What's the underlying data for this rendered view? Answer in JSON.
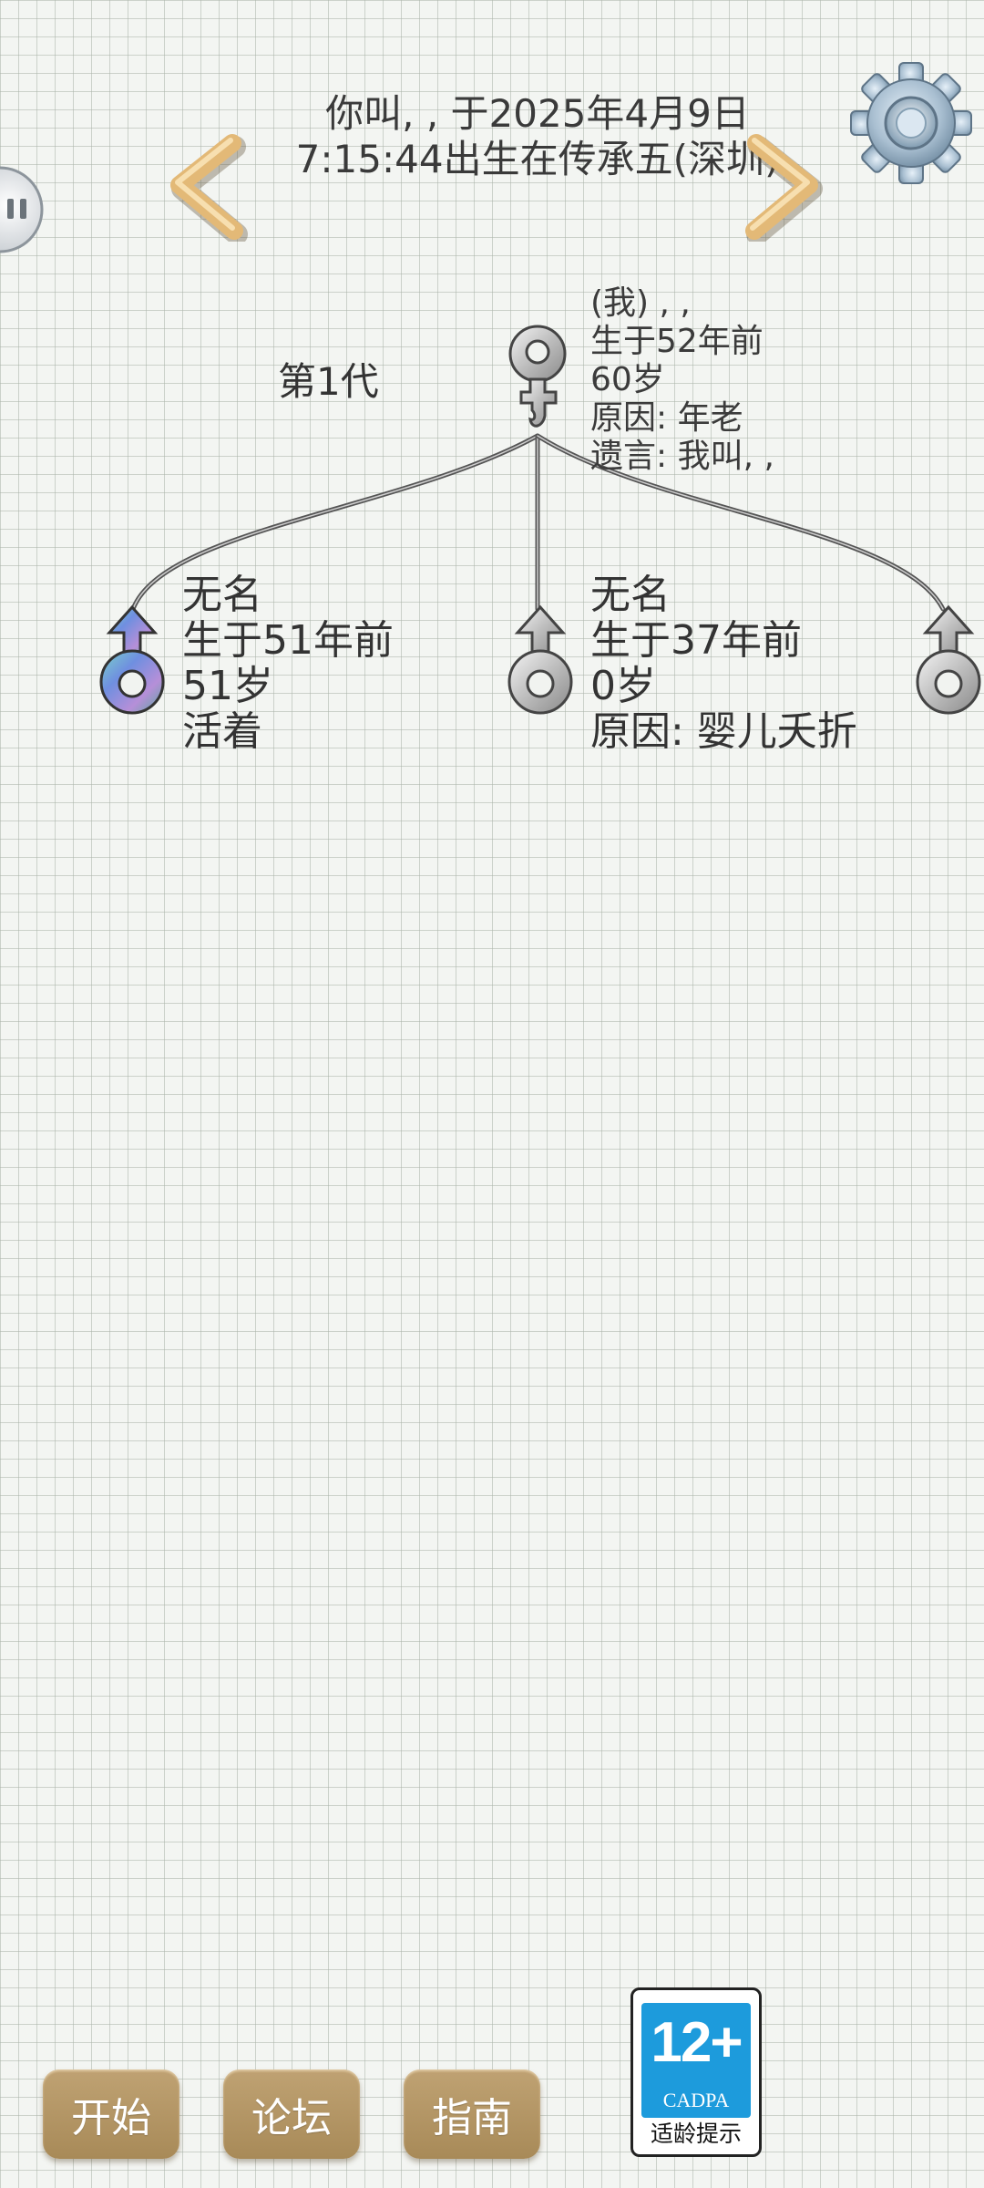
{
  "header": {
    "line1": "你叫, , 于2025年4月9日",
    "line2": "7:15:44出生在传承五(深圳)"
  },
  "generation_label": "第1代",
  "parent": {
    "lines": [
      "(我) , ,",
      "生于52年前",
      "60岁",
      "原因:  年老",
      "遗言:  我叫, ,"
    ],
    "gender": "female"
  },
  "children": [
    {
      "lines": [
        "无名",
        "生于51年前",
        "51岁",
        "活着"
      ],
      "gender": "male",
      "status": "alive"
    },
    {
      "lines": [
        "无名",
        "生于37年前",
        "0岁",
        "原因:  婴儿夭折"
      ],
      "gender": "male",
      "status": "dead"
    },
    {
      "lines": [],
      "gender": "male",
      "status": "dead"
    }
  ],
  "icons": {
    "prev": "chevron-left-icon",
    "next": "chevron-right-icon",
    "settings": "gear-icon",
    "side": "pause-tab-icon"
  },
  "buttons": {
    "start": "开始",
    "forum": "论坛",
    "guide": "指南"
  },
  "age_badge": {
    "rating": "12+",
    "org": "CADPA",
    "caption": "适龄提示"
  },
  "colors": {
    "button": "#b09060",
    "badge_blue": "#1d9bdc",
    "arrow": "#e0b870"
  }
}
